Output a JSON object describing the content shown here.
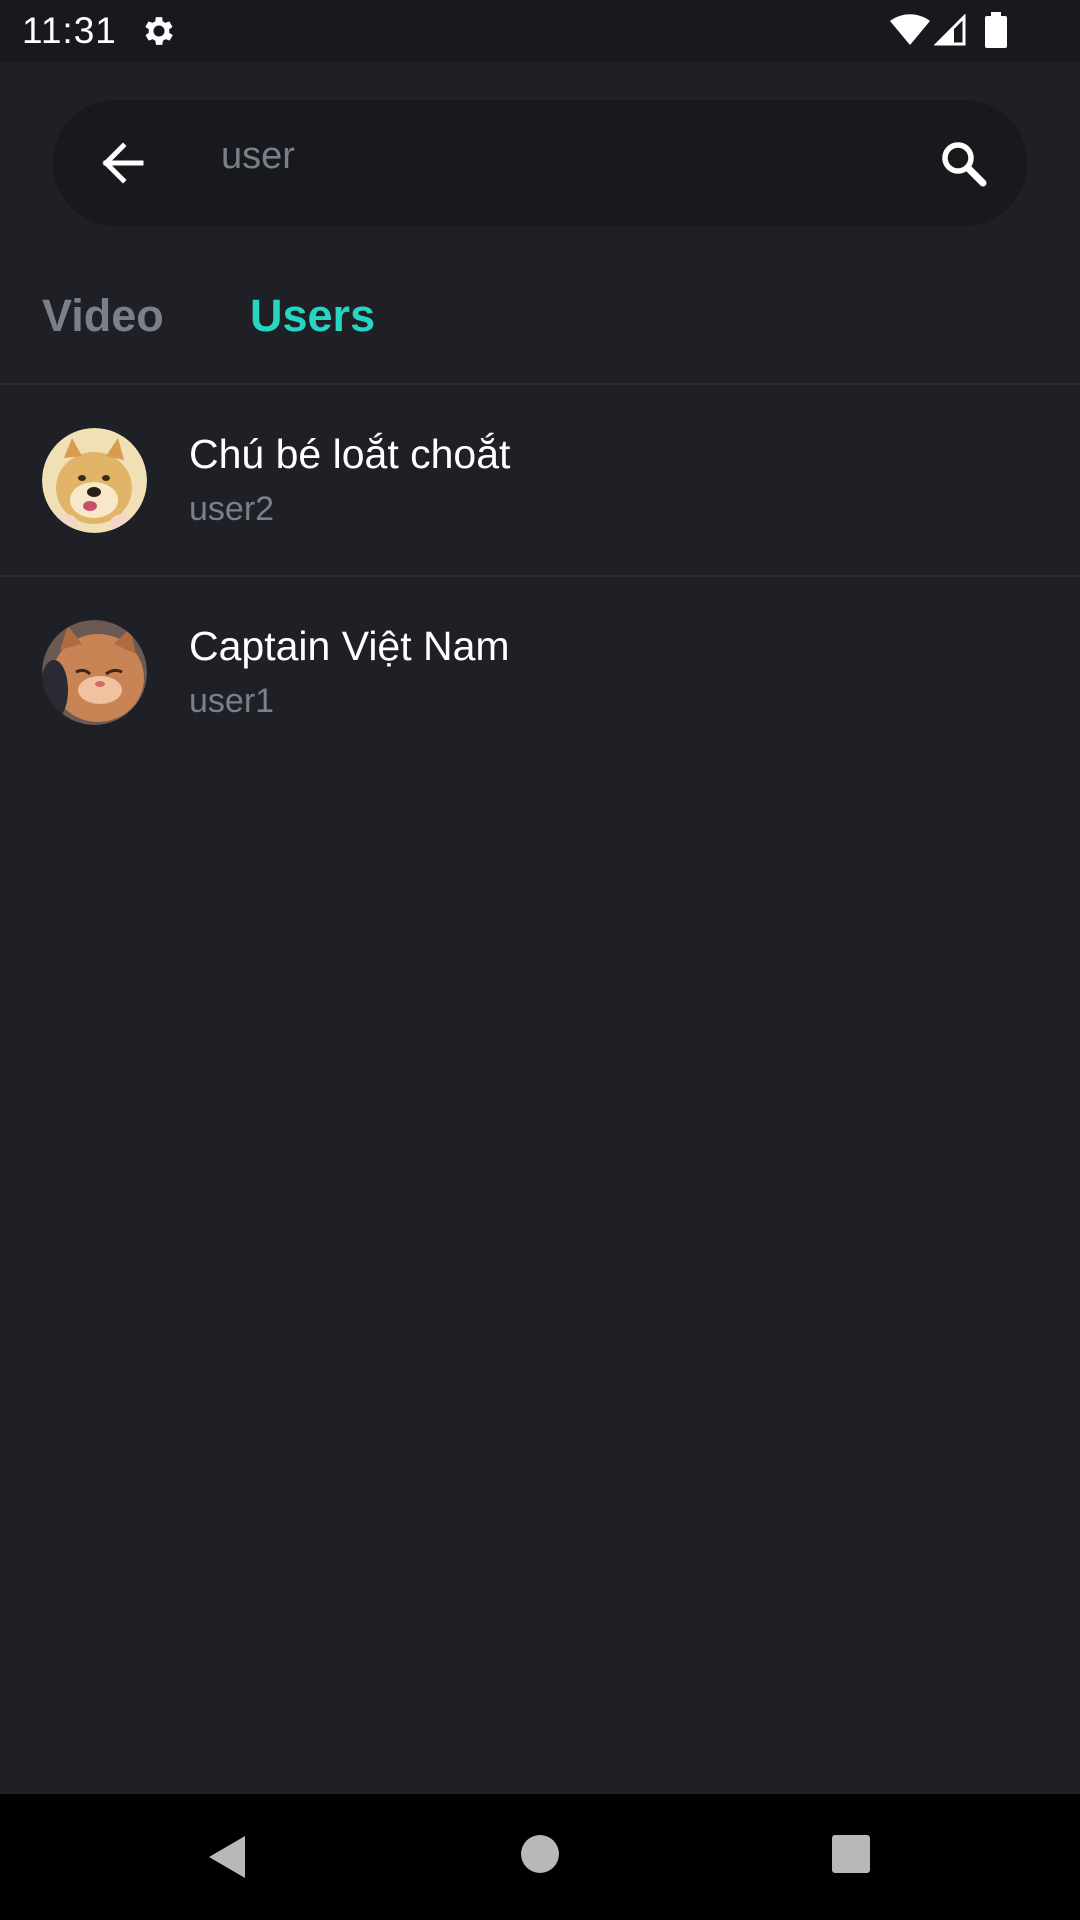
{
  "status_bar": {
    "time": "11:31",
    "icons": [
      "gear-icon",
      "wifi-icon",
      "signal-icon",
      "battery-icon"
    ]
  },
  "search": {
    "value": "",
    "placeholder": "user",
    "back_icon": "arrow-left-icon",
    "search_icon": "search-icon"
  },
  "tabs": [
    {
      "label": "Video",
      "active": false
    },
    {
      "label": "Users",
      "active": true
    }
  ],
  "users": [
    {
      "name": "Chú bé loắt choắt",
      "handle": "user2",
      "avatar": "shiba-dog-avatar"
    },
    {
      "name": "Captain Việt Nam",
      "handle": "user1",
      "avatar": "orange-cat-avatar"
    }
  ],
  "nav_bar": {
    "icons": [
      "nav-back-icon",
      "nav-home-icon",
      "nav-recents-icon"
    ]
  },
  "colors": {
    "background": "#1f2026",
    "search_background": "#18191d",
    "accent": "#28d4c2",
    "muted_text": "#7b7f8b",
    "divider": "#2c2d33"
  }
}
